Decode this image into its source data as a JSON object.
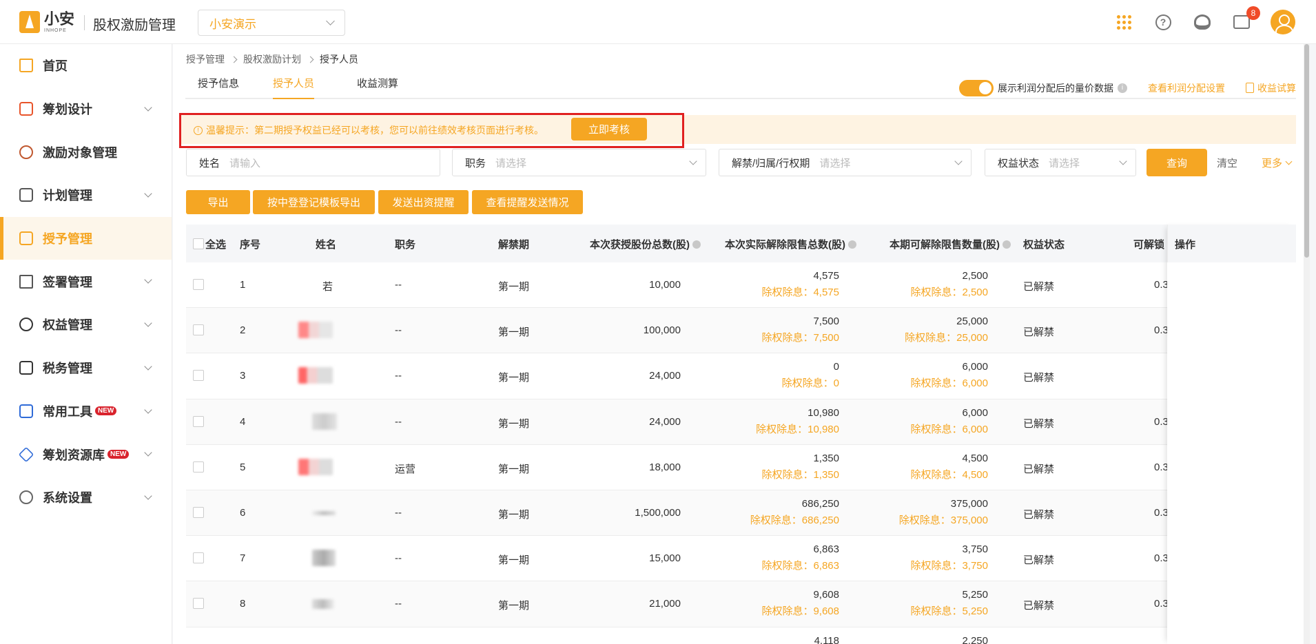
{
  "header": {
    "logo_cn": "小安",
    "logo_en": "INHOPE",
    "app_title": "股权激励管理",
    "org_select": "小安演示",
    "message_badge": "8"
  },
  "sidebar": {
    "items": [
      {
        "label": "首页"
      },
      {
        "label": "筹划设计"
      },
      {
        "label": "激励对象管理"
      },
      {
        "label": "计划管理"
      },
      {
        "label": "授予管理"
      },
      {
        "label": "签署管理"
      },
      {
        "label": "权益管理"
      },
      {
        "label": "税务管理"
      },
      {
        "label": "常用工具",
        "badge": "NEW"
      },
      {
        "label": "筹划资源库",
        "badge": "NEW"
      },
      {
        "label": "系统设置"
      }
    ]
  },
  "breadcrumb": [
    "授予管理",
    "股权激励计划",
    "授予人员"
  ],
  "tabs": [
    "授予信息",
    "授予人员",
    "收益测算"
  ],
  "tab_right": {
    "toggle_label": "展示利润分配后的量价数据",
    "profit_link": "查看利润分配设置",
    "trial_link": "收益试算"
  },
  "notice": {
    "text": "温馨提示：第二期授予权益已经可以考核，您可以前往绩效考核页面进行考核。",
    "button": "立即考核"
  },
  "filters": {
    "name_label": "姓名",
    "name_placeholder": "请输入",
    "position_label": "职务",
    "position_placeholder": "请选择",
    "period_label": "解禁/归属/行权期",
    "period_placeholder": "请选择",
    "status_label": "权益状态",
    "status_placeholder": "请选择",
    "query": "查询",
    "clear": "清空",
    "more": "更多"
  },
  "actions": [
    "导出",
    "按中登登记模板导出",
    "发送出资提醒",
    "查看提醒发送情况"
  ],
  "table": {
    "headers": {
      "select_all": "全选",
      "index": "序号",
      "name": "姓名",
      "position": "职务",
      "period": "解禁期",
      "granted": "本次获授股份总数(股)",
      "released": "本次实际解除限售总数(股)",
      "releasable": "本期可解除限售数量(股)",
      "status": "权益状态",
      "price": "可解锁",
      "ops": "操作"
    },
    "rows": [
      {
        "index": "1",
        "name": "若",
        "position": "--",
        "period": "第一期",
        "granted": "10,000",
        "released": "4,575",
        "released_adj": "除权除息：4,575",
        "releasable": "2,500",
        "releasable_adj": "除权除息：2,500",
        "status": "已解禁",
        "price": "0.3"
      },
      {
        "index": "2",
        "name": "",
        "position": "--",
        "period": "第一期",
        "granted": "100,000",
        "released": "7,500",
        "released_adj": "除权除息：7,500",
        "releasable": "25,000",
        "releasable_adj": "除权除息：25,000",
        "status": "已解禁",
        "price": "0.3"
      },
      {
        "index": "3",
        "name": "",
        "position": "--",
        "period": "第一期",
        "granted": "24,000",
        "released": "0",
        "released_adj": "除权除息：0",
        "releasable": "6,000",
        "releasable_adj": "除权除息：6,000",
        "status": "已解禁",
        "price": ""
      },
      {
        "index": "4",
        "name": "",
        "position": "--",
        "period": "第一期",
        "granted": "24,000",
        "released": "10,980",
        "released_adj": "除权除息：10,980",
        "releasable": "6,000",
        "releasable_adj": "除权除息：6,000",
        "status": "已解禁",
        "price": "0.3"
      },
      {
        "index": "5",
        "name": "",
        "position": "运营",
        "period": "第一期",
        "granted": "18,000",
        "released": "1,350",
        "released_adj": "除权除息：1,350",
        "releasable": "4,500",
        "releasable_adj": "除权除息：4,500",
        "status": "已解禁",
        "price": "0.3"
      },
      {
        "index": "6",
        "name": "",
        "position": "--",
        "period": "第一期",
        "granted": "1,500,000",
        "released": "686,250",
        "released_adj": "除权除息：686,250",
        "releasable": "375,000",
        "releasable_adj": "除权除息：375,000",
        "status": "已解禁",
        "price": "0.3"
      },
      {
        "index": "7",
        "name": "",
        "position": "--",
        "period": "第一期",
        "granted": "15,000",
        "released": "6,863",
        "released_adj": "除权除息：6,863",
        "releasable": "3,750",
        "releasable_adj": "除权除息：3,750",
        "status": "已解禁",
        "price": "0.3"
      },
      {
        "index": "8",
        "name": "",
        "position": "--",
        "period": "第一期",
        "granted": "21,000",
        "released": "9,608",
        "released_adj": "除权除息：9,608",
        "releasable": "5,250",
        "releasable_adj": "除权除息：5,250",
        "status": "已解禁",
        "price": "0.3"
      },
      {
        "index": "",
        "name": "",
        "position": "",
        "period": "",
        "granted": "",
        "released": "4,118",
        "released_adj": "",
        "releasable": "2,250",
        "releasable_adj": "",
        "status": "",
        "price": ""
      }
    ]
  }
}
